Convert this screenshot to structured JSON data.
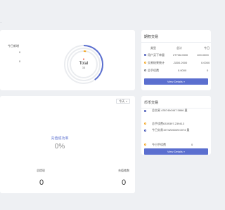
{
  "breadcrumb": "...",
  "overview": {
    "today_label": "今日新增",
    "values": [
      "0",
      "0"
    ],
    "donut": {
      "title": "Total",
      "total": "33"
    }
  },
  "contract_trading": {
    "title": "期权交易",
    "columns": [
      "类型",
      "总计",
      "今日"
    ],
    "rows": [
      {
        "dot_color": "#3f51b5",
        "type": "用户买下单量",
        "total": "27726.0000",
        "today": "100.0000"
      },
      {
        "dot_color": "#f4a623",
        "type": "交易结果统计",
        "total": "-3300.2000",
        "today": "0.0000"
      },
      {
        "dot_color": "#7a7f88",
        "type": "总手续费",
        "total": "0.0000",
        "today": "0"
      }
    ],
    "button": "View Details »"
  },
  "recharge": {
    "select_value": "今天",
    "success_rate_label": "充值成功率",
    "success_rate_value": "0%",
    "left_label": "总提现",
    "left_value": "0",
    "right_label": "充值笔数",
    "right_value": "0"
  },
  "coin_trading": {
    "title": "币币交易",
    "items": [
      {
        "dot_color": "#3f51b5",
        "text": "总交易 4357460467.5866 量"
      },
      {
        "dot_color": "#f4a623",
        "text": "总手续费6339397.239413"
      },
      {
        "dot_color": "#3f51b5",
        "text": "今日交易1974226049.0074 量"
      },
      {
        "dot_color": "#f4a623",
        "text": "今日手续费"
      },
      {
        "dot_color": "#f4a623",
        "text": "0"
      }
    ],
    "button": "View Details »"
  }
}
